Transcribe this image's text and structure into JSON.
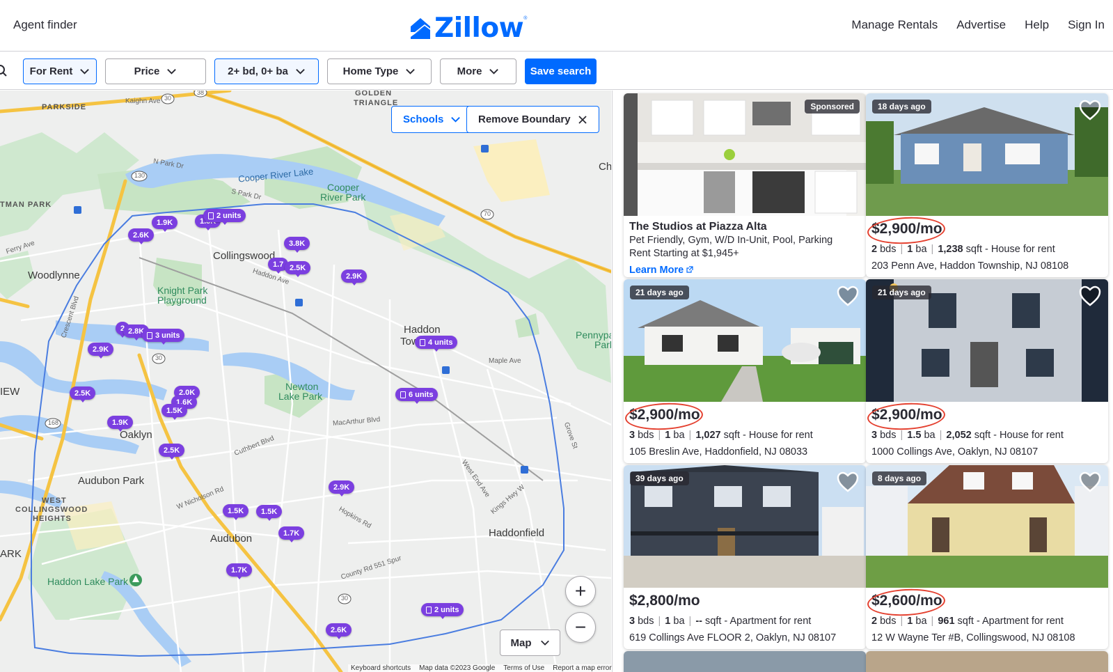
{
  "header": {
    "agent_finder": "Agent finder",
    "logo_text": "Zillow",
    "logo_reg": "®",
    "nav": [
      "Manage Rentals",
      "Advertise",
      "Help",
      "Sign In"
    ]
  },
  "filters": {
    "for_rent": "For Rent",
    "price": "Price",
    "beds_baths": "2+ bd, 0+ ba",
    "home_type": "Home Type",
    "more": "More",
    "save_search": "Save search"
  },
  "map": {
    "schools_label": "Schools",
    "remove_boundary_label": "Remove Boundary",
    "map_type_label": "Map",
    "zoom_in": "+",
    "zoom_out": "−",
    "attribution": [
      "Keyboard shortcuts",
      "Map data ©2023 Google",
      "Terms of Use",
      "Report a map error"
    ],
    "labels": {
      "parkside": "PARKSIDE",
      "golden_triangle_1": "GOLDEN",
      "golden_triangle_2": "TRIANGLE",
      "cooper_river_lake": "Cooper River Lake",
      "cooper_river_park_1": "Cooper",
      "cooper_river_park_2": "River Park",
      "tman_park": "TMAN PARK",
      "collingswood": "Collingswood",
      "woodlynne": "Woodlynne",
      "knight_park_1": "Knight Park",
      "knight_park_2": "Playground",
      "haddon_1": "Haddon",
      "haddon_2": "Tow",
      "newton_lake_1": "Newton",
      "newton_lake_2": "Lake Park",
      "oaklyn": "Oaklyn",
      "audubon_park": "Audubon Park",
      "west_collingswood_1": "WEST",
      "west_collingswood_2": "COLLINGSWOOD",
      "west_collingswood_3": "HEIGHTS",
      "audubon": "Audubon",
      "haddonfield": "Haddonfield",
      "haddon_lake_park": "Haddon Lake Park",
      "pennypack_1": "Pennypa",
      "pennypack_2": "Park",
      "ch": "Ch",
      "iew": "IEW",
      "ark": "ARK",
      "maple_ave": "Maple Ave",
      "macarthur_blvd": "MacArthur Blvd",
      "cuthbert_blvd": "Cuthbert Blvd",
      "crescent_blvd": "Crescent Blvd",
      "haddon_ave": "Haddon Ave",
      "kaighn_ave": "Kaighn Ave",
      "n_park_dr": "N Park Dr",
      "s_park_dr": "S Park Dr",
      "ferry_ave": "Ferry Ave",
      "w_nicholson_rd": "W Nicholson Rd",
      "hopkins_rd": "Hopkins Rd",
      "county_rd_551": "County Rd 551 Spur",
      "west_end_ave": "West End Ave",
      "kings_hwy": "Kings Hwy W",
      "grove_st": "Grove St",
      "route_30": "30",
      "route_130": "130",
      "route_38": "38",
      "route_70": "70",
      "route_168": "168"
    },
    "pins": [
      {
        "label": "1.9K"
      },
      {
        "label": "2.6K"
      },
      {
        "label": "1.3K"
      },
      {
        "label": "2 units",
        "building": true
      },
      {
        "label": "3.8K"
      },
      {
        "label": "1.7"
      },
      {
        "label": "2.5K"
      },
      {
        "label": "2.9K"
      },
      {
        "label": "2"
      },
      {
        "label": "2.8K"
      },
      {
        "label": "3 units",
        "building": true
      },
      {
        "label": "2.9K"
      },
      {
        "label": "4 units",
        "building": true
      },
      {
        "label": "2.5K"
      },
      {
        "label": "2.0K"
      },
      {
        "label": "1.6K"
      },
      {
        "label": "1.5K"
      },
      {
        "label": "6 units",
        "building": true
      },
      {
        "label": "1.9K"
      },
      {
        "label": "2.5K"
      },
      {
        "label": "2.9K"
      },
      {
        "label": "1.5K"
      },
      {
        "label": "1.5K"
      },
      {
        "label": "1.7K"
      },
      {
        "label": "1.7K"
      },
      {
        "label": "2 units",
        "building": true
      },
      {
        "label": "2.6K"
      }
    ]
  },
  "listings": [
    {
      "sponsored": true,
      "badge": "Sponsored",
      "title": "The Studios at Piazza Alta",
      "line1": "Pet Friendly, Gym, W/D In-Unit, Pool, Parking",
      "line2": "Rent Starting at $1,945+",
      "cta": "Learn More"
    },
    {
      "badge": "18 days ago",
      "price": "$2,900/mo",
      "beds": "2",
      "beds_unit": "bds",
      "baths": "1",
      "baths_unit": "ba",
      "sqft": "1,238",
      "sqft_unit": "sqft - House for rent",
      "address": "203 Penn Ave, Haddon Township, NJ 08108",
      "circled": true
    },
    {
      "badge": "21 days ago",
      "price": "$2,900/mo",
      "beds": "3",
      "beds_unit": "bds",
      "baths": "1",
      "baths_unit": "ba",
      "sqft": "1,027",
      "sqft_unit": "sqft - House for rent",
      "address": "105 Breslin Ave, Haddonfield, NJ 08033",
      "circled": true
    },
    {
      "badge": "21 days ago",
      "price": "$2,900/mo",
      "beds": "3",
      "beds_unit": "bds",
      "baths": "1.5",
      "baths_unit": "ba",
      "sqft": "2,052",
      "sqft_unit": "sqft - House for rent",
      "address": "1000 Collings Ave, Oaklyn, NJ 08107",
      "circled": true
    },
    {
      "badge": "39 days ago",
      "price": "$2,800/mo",
      "beds": "3",
      "beds_unit": "bds",
      "baths": "1",
      "baths_unit": "ba",
      "sqft": "--",
      "sqft_unit": "sqft - Apartment for rent",
      "address": "619 Collings Ave FLOOR 2, Oaklyn, NJ 08107",
      "circled": false
    },
    {
      "badge": "8 days ago",
      "price": "$2,600/mo",
      "beds": "2",
      "beds_unit": "bds",
      "baths": "1",
      "baths_unit": "ba",
      "sqft": "961",
      "sqft_unit": "sqft - Apartment for rent",
      "address": "12 W Wayne Ter #B, Collingswood, NJ 08108",
      "circled": true
    }
  ],
  "colors": {
    "brand": "#006aff",
    "pin": "#7b3fe0",
    "annotation_ring": "#e4402f",
    "boundary": "#4a7de0"
  },
  "icons": [
    "zillow-logo-icon",
    "chevron-down-icon",
    "search-icon",
    "heart-icon",
    "close-icon",
    "building-icon",
    "external-link-icon",
    "transit-icon",
    "park-icon"
  ]
}
